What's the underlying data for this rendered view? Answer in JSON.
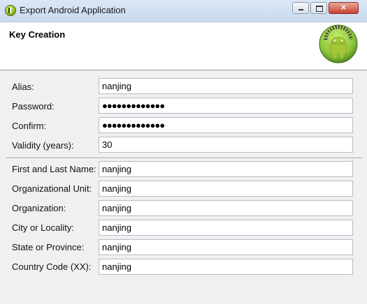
{
  "window": {
    "title": "Export Android Application"
  },
  "header": {
    "title": "Key Creation"
  },
  "form": {
    "alias": {
      "label": "Alias:",
      "value": "nanjing"
    },
    "password": {
      "label": "Password:",
      "value": "●●●●●●●●●●●●●"
    },
    "confirm": {
      "label": "Confirm:",
      "value": "●●●●●●●●●●●●●"
    },
    "validity": {
      "label": "Validity (years):",
      "value": "30"
    },
    "name": {
      "label": "First and Last Name:",
      "value": "nanjing"
    },
    "org_unit": {
      "label": "Organizational Unit:",
      "value": "nanjing"
    },
    "org": {
      "label": "Organization:",
      "value": "nanjing"
    },
    "city": {
      "label": "City or Locality:",
      "value": "nanjing"
    },
    "state": {
      "label": "State or Province:",
      "value": "nanjing"
    },
    "country": {
      "label": "Country Code (XX):",
      "value": "nanjing"
    }
  }
}
